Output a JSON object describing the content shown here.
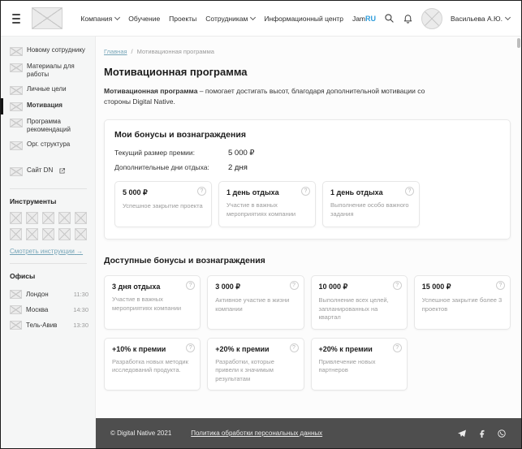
{
  "icons": {
    "help": "?",
    "arrow_right": "→",
    "separator": "/"
  },
  "header": {
    "nav": [
      {
        "label": "Компания"
      },
      {
        "label": "Обучение"
      },
      {
        "label": "Проекты"
      },
      {
        "label": "Сотрудникам"
      },
      {
        "label": "Информационный центр"
      },
      {
        "label": "Jam"
      }
    ],
    "lang": "RU",
    "user_name": "Васильева А.Ю."
  },
  "sidebar": {
    "items": [
      "Новому сотруднику",
      "Материалы для работы",
      "Личные цели",
      "Мотивация",
      "Программа рекомендаций",
      "Орг. структура"
    ],
    "site_link": "Сайт DN",
    "tools_title": "Инструменты",
    "tools_link": "Смотреть инструкции",
    "offices_title": "Офисы",
    "offices": [
      {
        "city": "Лондон",
        "time": "11:30"
      },
      {
        "city": "Москва",
        "time": "14:30"
      },
      {
        "city": "Тель-Авив",
        "time": "13:30"
      }
    ]
  },
  "breadcrumb": {
    "home": "Главная",
    "current": "Мотивационная программа"
  },
  "page": {
    "title": "Мотивационная программа",
    "intro_bold": "Мотивационная программа",
    "intro_rest": " – помогает достигать высот, благодаря дополнительной мотивации со стороны Digital Native."
  },
  "my_bonuses": {
    "title": "Мои бонусы и вознаграждения",
    "rows": [
      {
        "label": "Текущий размер премии:",
        "value": "5 000 ₽"
      },
      {
        "label": "Дополнительные дни отдыха:",
        "value": "2 дня"
      }
    ],
    "cards": [
      {
        "title": "5 000 ₽",
        "desc": "Успешное закрытие проекта"
      },
      {
        "title": "1 день отдыха",
        "desc": "Участие в важных мероприятиях компании"
      },
      {
        "title": "1 день отдыха",
        "desc": "Выполнение особо важного задания"
      }
    ]
  },
  "available": {
    "title": "Доступные бонусы и вознаграждения",
    "row1": [
      {
        "title": "3 дня отдыха",
        "desc": "Участие в важных мероприятиях компании"
      },
      {
        "title": "3 000 ₽",
        "desc": "Активное участие в жизни компании"
      },
      {
        "title": "10 000 ₽",
        "desc": "Выполнение всех целей, запланированных на квартал"
      },
      {
        "title": "15 000 ₽",
        "desc": "Успешное закрытие более 3 проектов"
      }
    ],
    "row2": [
      {
        "title": "+10% к премии",
        "desc": "Разработка новых методик исследований продукта."
      },
      {
        "title": "+20% к премии",
        "desc": "Разработки, которые привели к значимым результатам"
      },
      {
        "title": "+20% к премии",
        "desc": "Привлечение новых партнеров"
      }
    ]
  },
  "footer": {
    "copyright": "© Digital Native 2021",
    "policy": "Политика обработки персональных данных"
  }
}
